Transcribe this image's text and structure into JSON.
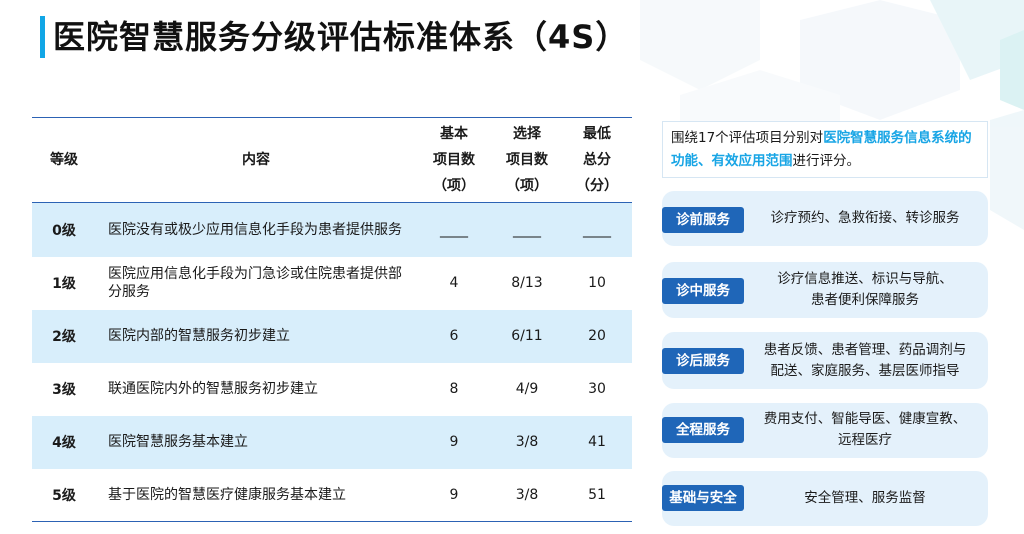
{
  "title": "医院智慧服务分级评估标准体系（4S）",
  "table": {
    "headers": {
      "level": "等级",
      "content": "内容",
      "basic": [
        "基本",
        "项目数",
        "（项）"
      ],
      "optional": [
        "选择",
        "项目数",
        "（项）"
      ],
      "min_score": [
        "最低",
        "总分",
        "（分）"
      ]
    },
    "rows": [
      {
        "level": "0级",
        "content": "医院没有或极少应用信息化手段为患者提供服务",
        "basic": "____",
        "optional": "____",
        "min_score": "____"
      },
      {
        "level": "1级",
        "content": "医院应用信息化手段为门急诊或住院患者提供部分服务",
        "basic": "4",
        "optional": "8/13",
        "min_score": "10"
      },
      {
        "level": "2级",
        "content": "医院内部的智慧服务初步建立",
        "basic": "6",
        "optional": "6/11",
        "min_score": "20"
      },
      {
        "level": "3级",
        "content": "联通医院内外的智慧服务初步建立",
        "basic": "8",
        "optional": "4/9",
        "min_score": "30"
      },
      {
        "level": "4级",
        "content": "医院智慧服务基本建立",
        "basic": "9",
        "optional": "3/8",
        "min_score": "41"
      },
      {
        "level": "5级",
        "content": "基于医院的智慧医疗健康服务基本建立",
        "basic": "9",
        "optional": "3/8",
        "min_score": "51"
      }
    ]
  },
  "note": {
    "prefix": "围绕17个评估项目分别对",
    "highlight": "医院智慧服务信息系统的功能、有效应用范围",
    "suffix": "进行评分。"
  },
  "categories": [
    {
      "label": "诊前服务",
      "lines": [
        "诊疗预约、急救衔接、转诊服务"
      ]
    },
    {
      "label": "诊中服务",
      "lines": [
        "诊疗信息推送、标识与导航、",
        "患者便利保障服务"
      ]
    },
    {
      "label": "诊后服务",
      "lines": [
        "患者反馈、患者管理、药品调剂与",
        "配送、家庭服务、基层医师指导"
      ]
    },
    {
      "label": "全程服务",
      "lines": [
        "费用支付、智能导医、健康宣教、",
        "远程医疗"
      ]
    },
    {
      "label": "基础与安全",
      "lines": [
        "安全管理、服务监督"
      ]
    }
  ],
  "colors": {
    "accent": "#11a6e6",
    "badge": "#1f66b8",
    "row_highlight": "#d8eefb",
    "rule": "#2c62b4"
  }
}
